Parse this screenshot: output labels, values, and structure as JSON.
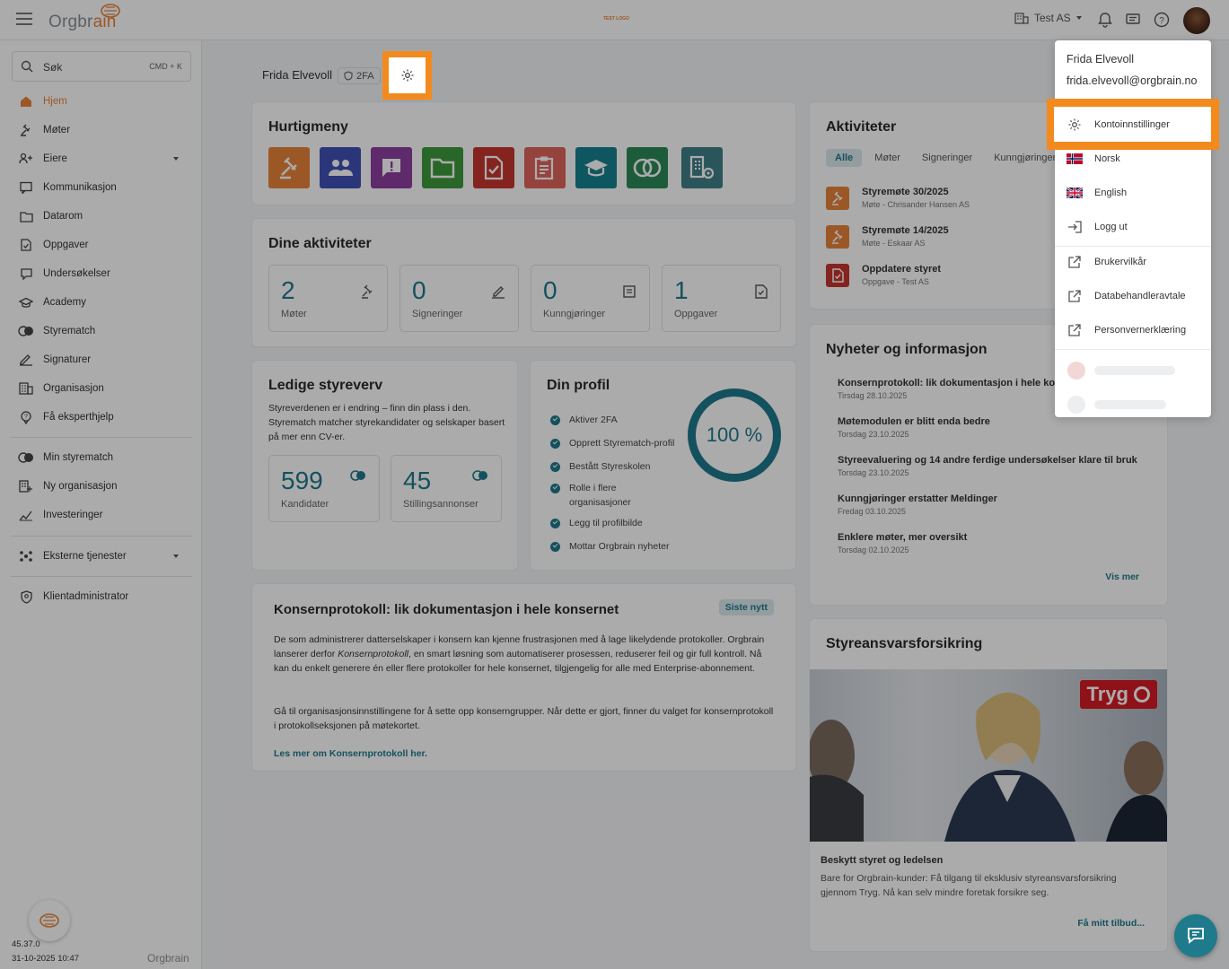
{
  "brand": {
    "logo_text_a": "Orgbr",
    "logo_text_b": "ain",
    "test_logo": "TEST LOGO"
  },
  "topbar": {
    "org_name": "Test AS"
  },
  "search": {
    "label": "Søk",
    "shortcut": "CMD + K"
  },
  "sidebar": {
    "items": [
      {
        "label": "Hjem"
      },
      {
        "label": "Møter"
      },
      {
        "label": "Eiere"
      },
      {
        "label": "Kommunikasjon"
      },
      {
        "label": "Datarom"
      },
      {
        "label": "Oppgaver"
      },
      {
        "label": "Undersøkelser"
      },
      {
        "label": "Academy"
      },
      {
        "label": "Styrematch"
      },
      {
        "label": "Signaturer"
      },
      {
        "label": "Organisasjon"
      },
      {
        "label": "Få eksperthjelp"
      }
    ],
    "items2": [
      {
        "label": "Min styrematch"
      },
      {
        "label": "Ny organisasjon"
      },
      {
        "label": "Investeringer"
      }
    ],
    "items3": [
      {
        "label": "Eksterne tjenester"
      }
    ],
    "items4": [
      {
        "label": "Klientadministrator"
      }
    ],
    "version": "45.37.0",
    "timestamp": "31-10-2025 10:47",
    "brand": "Orgbrain"
  },
  "user": {
    "name": "Frida Elvevoll",
    "tfa": "2FA",
    "email": "frida.elvevoll@orgbrain.no"
  },
  "quickmenu": {
    "title": "Hurtigmeny"
  },
  "activities": {
    "title": "Dine aktiviteter",
    "stats": [
      {
        "num": "2",
        "label": "Møter"
      },
      {
        "num": "0",
        "label": "Signeringer"
      },
      {
        "num": "0",
        "label": "Kunngjøringer"
      },
      {
        "num": "1",
        "label": "Oppgaver"
      }
    ]
  },
  "board": {
    "title": "Ledige styreverv",
    "desc": "Styreverdenen er i endring – finn din plass i den. Styrematch matcher styrekandidater og selskaper basert på mer enn CV-er.",
    "stats": [
      {
        "num": "599",
        "label": "Kandidater"
      },
      {
        "num": "45",
        "label": "Stillingsannonser"
      }
    ]
  },
  "profile": {
    "title": "Din profil",
    "progress_pct": 100,
    "progress_label": "100 %",
    "items": [
      "Aktiver 2FA",
      "Opprett Styrematch-profil",
      "Bestått Styreskolen",
      "Rolle i flere organisasjoner",
      "Legg til profilbilde",
      "Mottar Orgbrain nyheter"
    ]
  },
  "news_card": {
    "title": "Konsernprotokoll: lik dokumentasjon i hele konsernet",
    "badge": "Siste nytt",
    "p1a": "De som administrerer datterselskaper i konsern kan kjenne frustrasjonen med å lage likelydende protokoller. Orgbrain lanserer derfor ",
    "p1b": "Konsernprotokoll",
    "p1c": ", en smart løsning som automatiserer prosessen, reduserer feil og gir full kontroll. Nå kan du enkelt generere én eller flere protokoller for hele konsernet, tilgjengelig for alle med Enterprise-abonnement.",
    "p2": "Gå til organisasjonsinnstillingene for å sette opp konserngrupper. Når dette er gjort, finner du valget for konsernprotokoll i protokollseksjonen på møtekortet.",
    "link": "Les mer om Konsernprotokoll her."
  },
  "aktiviteter": {
    "title": "Aktiviteter",
    "tabs": [
      "Alle",
      "Møter",
      "Signeringer",
      "Kunngjøringer"
    ],
    "items": [
      {
        "title": "Styremøte 30/2025",
        "sub": "Møte - Chrisander Hansen AS"
      },
      {
        "title": "Styremøte 14/2025",
        "sub": "Møte - Eskaar AS"
      },
      {
        "title": "Oppdatere styret",
        "sub": "Oppgave - Test AS"
      }
    ]
  },
  "news": {
    "title": "Nyheter og informasjon",
    "items": [
      {
        "title": "Konsernprotokoll: lik dokumentasjon i hele konse",
        "date": "Tirsdag 28.10.2025"
      },
      {
        "title": "Møtemodulen er blitt enda bedre",
        "date": "Torsdag 23.10.2025"
      },
      {
        "title": "Styreevaluering og 14 andre ferdige undersøkelser klare til bruk",
        "date": "Torsdag 23.10.2025"
      },
      {
        "title": "Kunngjøringer erstatter Meldinger",
        "date": "Fredag 03.10.2025"
      },
      {
        "title": "Enklere møter, mer oversikt",
        "date": "Torsdag 02.10.2025"
      }
    ],
    "more": "Vis mer"
  },
  "insurance": {
    "title": "Styreansvarsforsikring",
    "brand": "Tryg",
    "subtitle": "Beskytt styret og ledelsen",
    "desc": "Bare for Orgbrain-kunder: Få tilgang til eksklusiv styreansvarsforsikring gjennom Tryg. Nå kan selv mindre foretak forsikre seg.",
    "cta": "Få mitt tilbud..."
  },
  "dropdown": {
    "settings": "Kontoinnstillinger",
    "norsk": "Norsk",
    "english": "English",
    "logout": "Logg ut",
    "terms": "Brukervilkår",
    "dpa": "Databehandleravtale",
    "privacy": "Personvernerklæring"
  },
  "colors": {
    "accent": "#e8833a",
    "teal": "#1f7a8c",
    "highlight": "#f28a1e"
  }
}
